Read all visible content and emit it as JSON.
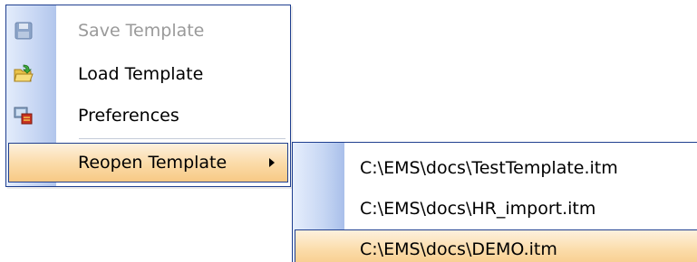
{
  "main_menu": {
    "items": [
      {
        "label": "Save Template",
        "icon": "save-icon",
        "disabled": true
      },
      {
        "label": "Load Template",
        "icon": "open-folder-icon",
        "disabled": false
      },
      {
        "label": "Preferences",
        "icon": "preferences-icon",
        "disabled": false
      },
      {
        "label": "Reopen Template",
        "icon": "submenu-arrow-icon",
        "highlighted": true
      }
    ]
  },
  "reopen_submenu": {
    "items": [
      {
        "label": "C:\\EMS\\docs\\TestTemplate.itm"
      },
      {
        "label": "C:\\EMS\\docs\\HR_import.itm"
      },
      {
        "label": "C:\\EMS\\docs\\DEMO.itm",
        "highlighted": true
      }
    ]
  },
  "colors": {
    "menu_border": "#1f3f8f",
    "gutter_blue": "#c9d8f4",
    "highlight_orange": "#fbdcaa",
    "disabled_text": "#9a9a9a"
  }
}
